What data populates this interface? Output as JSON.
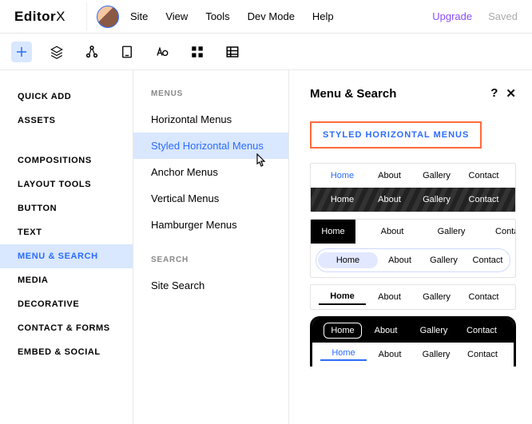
{
  "top": {
    "logo_main": "Editor",
    "logo_thin": "X",
    "site": "Site",
    "view": "View",
    "tools": "Tools",
    "dev": "Dev Mode",
    "help": "Help",
    "upgrade": "Upgrade",
    "saved": "Saved"
  },
  "sidebar": {
    "quick_add": "QUICK ADD",
    "assets": "ASSETS",
    "compositions": "COMPOSITIONS",
    "layout": "LAYOUT TOOLS",
    "button": "BUTTON",
    "text": "TEXT",
    "menu_search": "MENU & SEARCH",
    "media": "MEDIA",
    "decorative": "DECORATIVE",
    "contact": "CONTACT & FORMS",
    "embed": "EMBED & SOCIAL"
  },
  "sub": {
    "head_menus": "MENUS",
    "horizontal": "Horizontal Menus",
    "styled": "Styled Horizontal Menus",
    "anchor": "Anchor Menus",
    "vertical": "Vertical Menus",
    "hamburger": "Hamburger Menus",
    "head_search": "SEARCH",
    "site_search": "Site Search"
  },
  "preview": {
    "title": "Menu & Search",
    "help": "?",
    "close": "✕",
    "section": "STYLED HORIZONTAL MENUS",
    "items": {
      "home": "Home",
      "about": "About",
      "gallery": "Gallery",
      "contact": "Contact"
    }
  }
}
